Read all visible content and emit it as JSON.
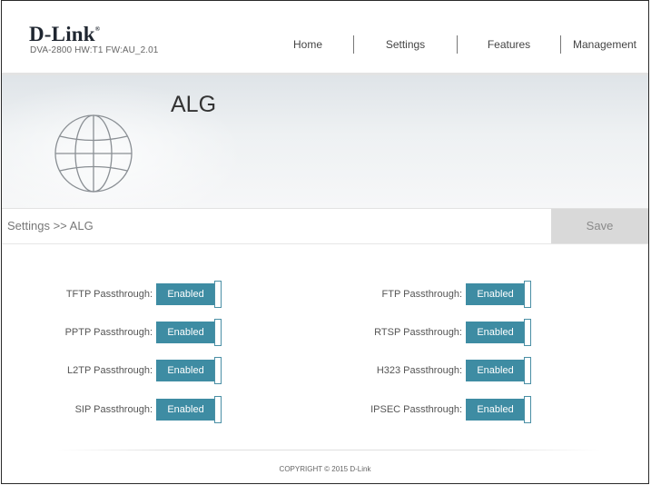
{
  "header": {
    "logo": "D-Link",
    "model_info": "DVA-2800   HW:T1   FW:AU_2.01",
    "nav": [
      "Home",
      "Settings",
      "Features",
      "Management"
    ]
  },
  "banner": {
    "title": "ALG"
  },
  "breadcrumb": "Settings >> ALG",
  "save_label": "Save",
  "settings": {
    "left": [
      {
        "label": "TFTP Passthrough:",
        "value": "Enabled"
      },
      {
        "label": "PPTP Passthrough:",
        "value": "Enabled"
      },
      {
        "label": "L2TP Passthrough:",
        "value": "Enabled"
      },
      {
        "label": "SIP Passthrough:",
        "value": "Enabled"
      }
    ],
    "right": [
      {
        "label": "FTP Passthrough:",
        "value": "Enabled"
      },
      {
        "label": "RTSP Passthrough:",
        "value": "Enabled"
      },
      {
        "label": "H323 Passthrough:",
        "value": "Enabled"
      },
      {
        "label": "IPSEC Passthrough:",
        "value": "Enabled"
      }
    ]
  },
  "footer": {
    "copyright": "COPYRIGHT © 2015 D-Link"
  },
  "colors": {
    "toggle_enabled": "#3e8ca3",
    "save_bg": "#d9d9d9"
  }
}
